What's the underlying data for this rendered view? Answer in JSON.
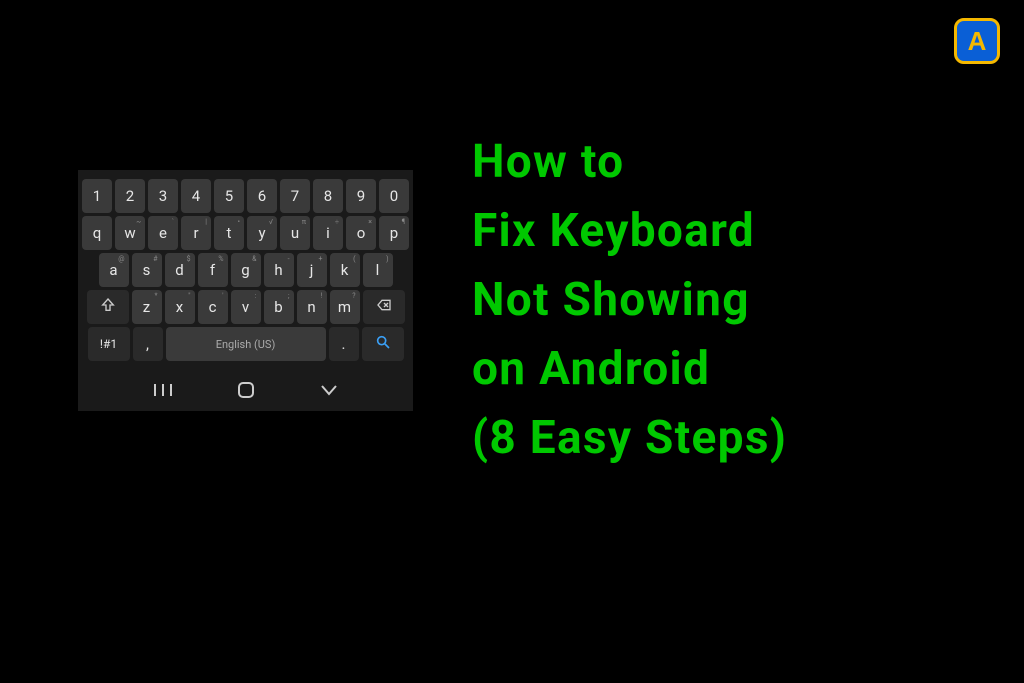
{
  "logo": {
    "letter": "A"
  },
  "title": {
    "line1": "How to",
    "line2": "Fix Keyboard",
    "line3": "Not Showing",
    "line4": "on Android",
    "line5": "(8 Easy Steps)"
  },
  "keyboard": {
    "row1": [
      "1",
      "2",
      "3",
      "4",
      "5",
      "6",
      "7",
      "8",
      "9",
      "0"
    ],
    "row2": [
      {
        "main": "q"
      },
      {
        "main": "w",
        "sec": "~"
      },
      {
        "main": "e",
        "sec": "`"
      },
      {
        "main": "r",
        "sec": "|"
      },
      {
        "main": "t",
        "sec": "•"
      },
      {
        "main": "y",
        "sec": "√"
      },
      {
        "main": "u",
        "sec": "π"
      },
      {
        "main": "i",
        "sec": "÷"
      },
      {
        "main": "o",
        "sec": "×"
      },
      {
        "main": "p",
        "sec": "¶"
      }
    ],
    "row3": [
      {
        "main": "a",
        "sec": "@"
      },
      {
        "main": "s",
        "sec": "#"
      },
      {
        "main": "d",
        "sec": "$"
      },
      {
        "main": "f",
        "sec": "%"
      },
      {
        "main": "g",
        "sec": "&"
      },
      {
        "main": "h",
        "sec": "-"
      },
      {
        "main": "j",
        "sec": "+"
      },
      {
        "main": "k",
        "sec": "("
      },
      {
        "main": "l",
        "sec": ")"
      }
    ],
    "row4": [
      {
        "main": "z",
        "sec": "*"
      },
      {
        "main": "x",
        "sec": "\""
      },
      {
        "main": "c",
        "sec": "'"
      },
      {
        "main": "v",
        "sec": ":"
      },
      {
        "main": "b",
        "sec": ";"
      },
      {
        "main": "n",
        "sec": "!"
      },
      {
        "main": "m",
        "sec": "?"
      }
    ],
    "row5": {
      "sym": "!#1",
      "comma": ",",
      "space": "English (US)",
      "period": "."
    }
  }
}
